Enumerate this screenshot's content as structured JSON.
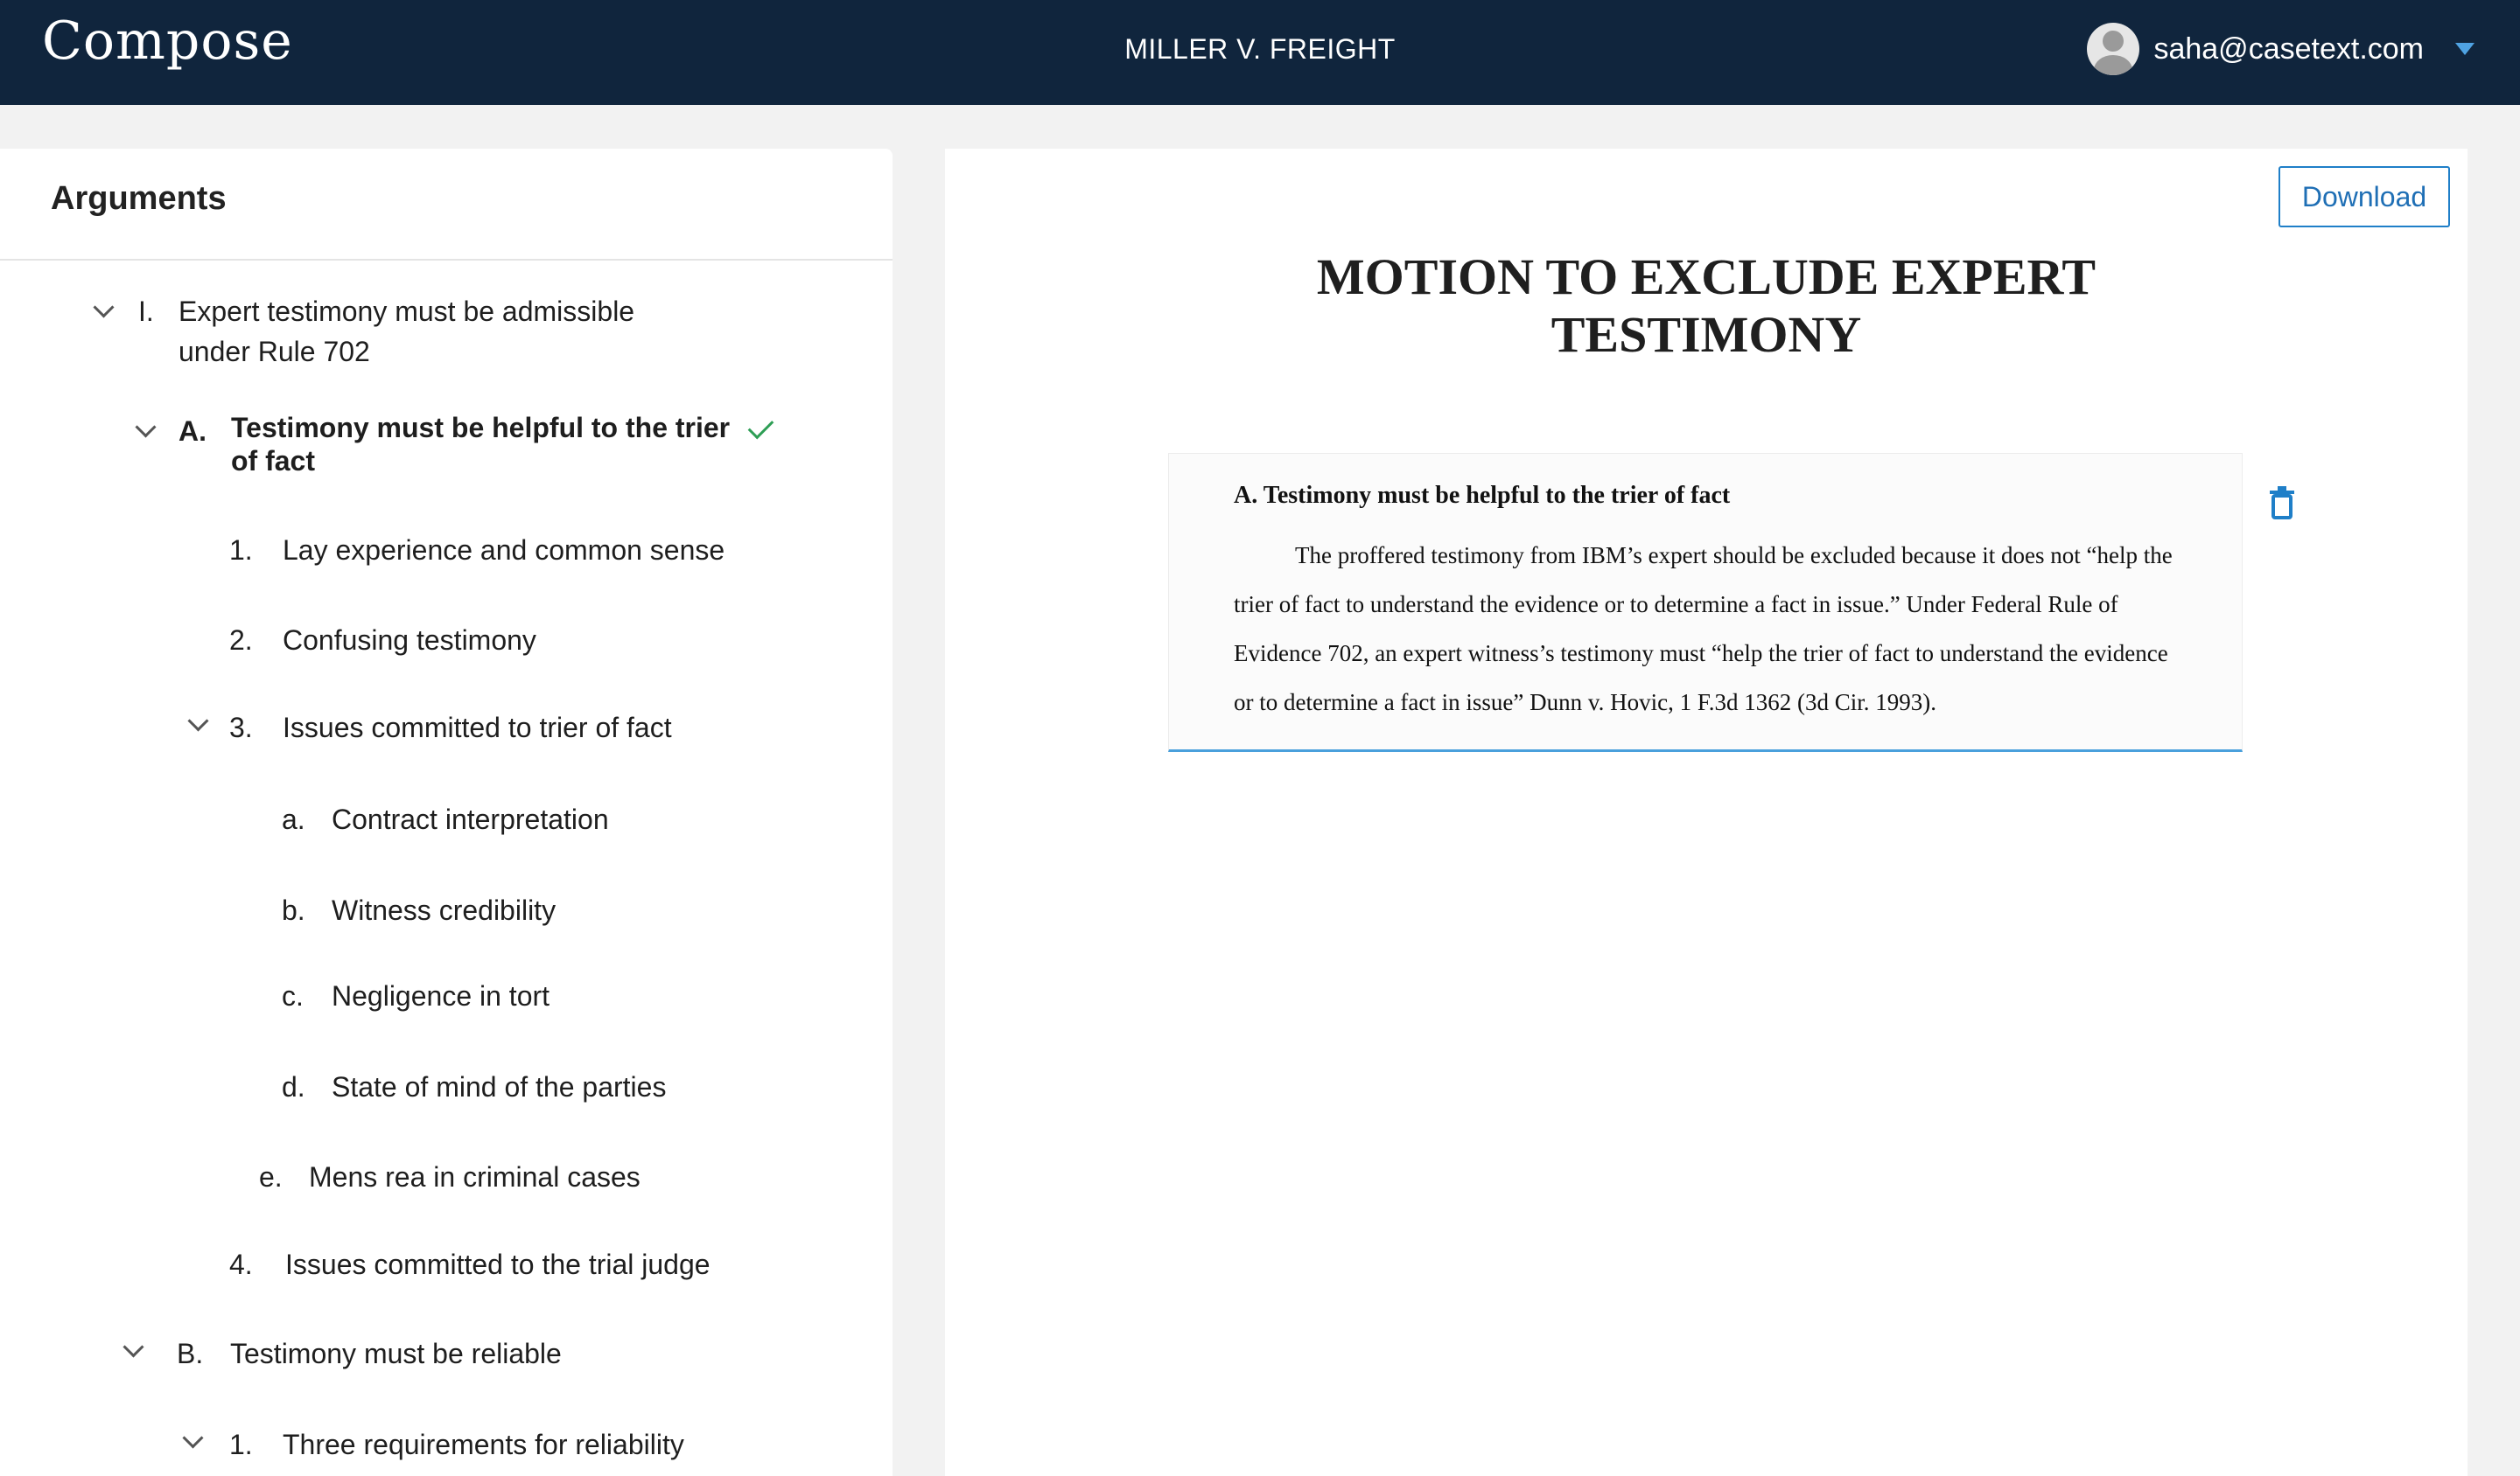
{
  "header": {
    "brand": "Compose",
    "case_title": "MILLER V. FREIGHT",
    "user_email": "saha@casetext.com"
  },
  "sidebar": {
    "title": "Arguments",
    "items": [
      {
        "marker": "I.",
        "label_line1": "Expert testimony must be admissible",
        "label_line2": "under Rule 702"
      },
      {
        "marker": "A.",
        "label_line1": "Testimony must be helpful to the trier",
        "label_line2": "of fact"
      },
      {
        "marker": "1.",
        "label": "Lay experience and common sense"
      },
      {
        "marker": "2.",
        "label": "Confusing testimony"
      },
      {
        "marker": "3.",
        "label": "Issues committed to trier of fact"
      },
      {
        "marker": "a.",
        "label": "Contract interpretation"
      },
      {
        "marker": "b.",
        "label": "Witness credibility"
      },
      {
        "marker": "c.",
        "label": "Negligence in tort"
      },
      {
        "marker": "d.",
        "label": "State of mind of the parties"
      },
      {
        "marker": "e.",
        "label": "Mens rea in criminal cases"
      },
      {
        "marker": "4.",
        "label": "Issues committed to the trial judge"
      },
      {
        "marker": "B.",
        "label": "Testimony must be reliable"
      },
      {
        "marker": "1.",
        "label": "Three requirements for reliability"
      }
    ]
  },
  "document": {
    "download_label": "Download",
    "title_line1": "MOTION TO EXCLUDE EXPERT",
    "title_line2": "TESTIMONY",
    "section": {
      "heading": "A. Testimony must be helpful to the trier of fact",
      "body": "The proffered testimony from IBM’s expert should be excluded because it does not “help the trier of fact to understand the evidence or to determine a fact in issue.” Under Federal Rule of Evidence 702, an expert witness’s testimony must “help the trier of fact to understand the evidence or to determine a fact in issue” Dunn v. Hovic, 1 F.3d 1362 (3d Cir. 1993)."
    }
  },
  "colors": {
    "header_bg": "#10253d",
    "accent_blue": "#1f7fc8",
    "check_green": "#2e9e55"
  },
  "icons": [
    "user-avatar-icon",
    "caret-down-icon",
    "chevron-down-icon",
    "check-icon",
    "trash-icon"
  ]
}
